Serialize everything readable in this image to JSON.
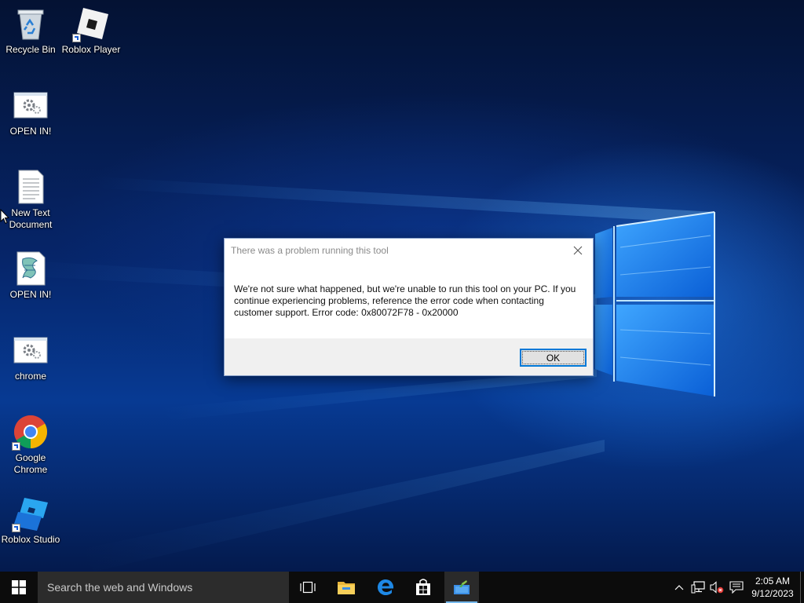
{
  "desktop": {
    "icons": [
      {
        "id": "recycle-bin",
        "label": "Recycle Bin",
        "icon": "recycle-bin-icon"
      },
      {
        "id": "roblox-player",
        "label": "Roblox Player",
        "icon": "roblox-player-icon"
      },
      {
        "id": "open-in-1",
        "label": "OPEN IN!",
        "icon": "settings-window-icon"
      },
      {
        "id": "new-text-document",
        "label": "New Text Document",
        "icon": "text-document-icon"
      },
      {
        "id": "open-in-2",
        "label": "OPEN IN!",
        "icon": "script-file-icon"
      },
      {
        "id": "chrome-file",
        "label": "chrome",
        "icon": "settings-window-icon"
      },
      {
        "id": "google-chrome",
        "label": "Google Chrome",
        "icon": "chrome-icon"
      },
      {
        "id": "roblox-studio",
        "label": "Roblox Studio",
        "icon": "roblox-studio-icon"
      }
    ]
  },
  "dialog": {
    "title": "There was a problem running this tool",
    "message": "We're not sure what happened, but we're unable to run this tool on your PC. If you continue experiencing problems, reference the error code when contacting customer support. Error code: 0x80072F78 - 0x20000",
    "ok_label": "OK"
  },
  "taskbar": {
    "search_placeholder": "Search the web and Windows",
    "clock_time": "2:05 AM",
    "clock_date": "9/12/2023",
    "accent": "#0078d7"
  }
}
